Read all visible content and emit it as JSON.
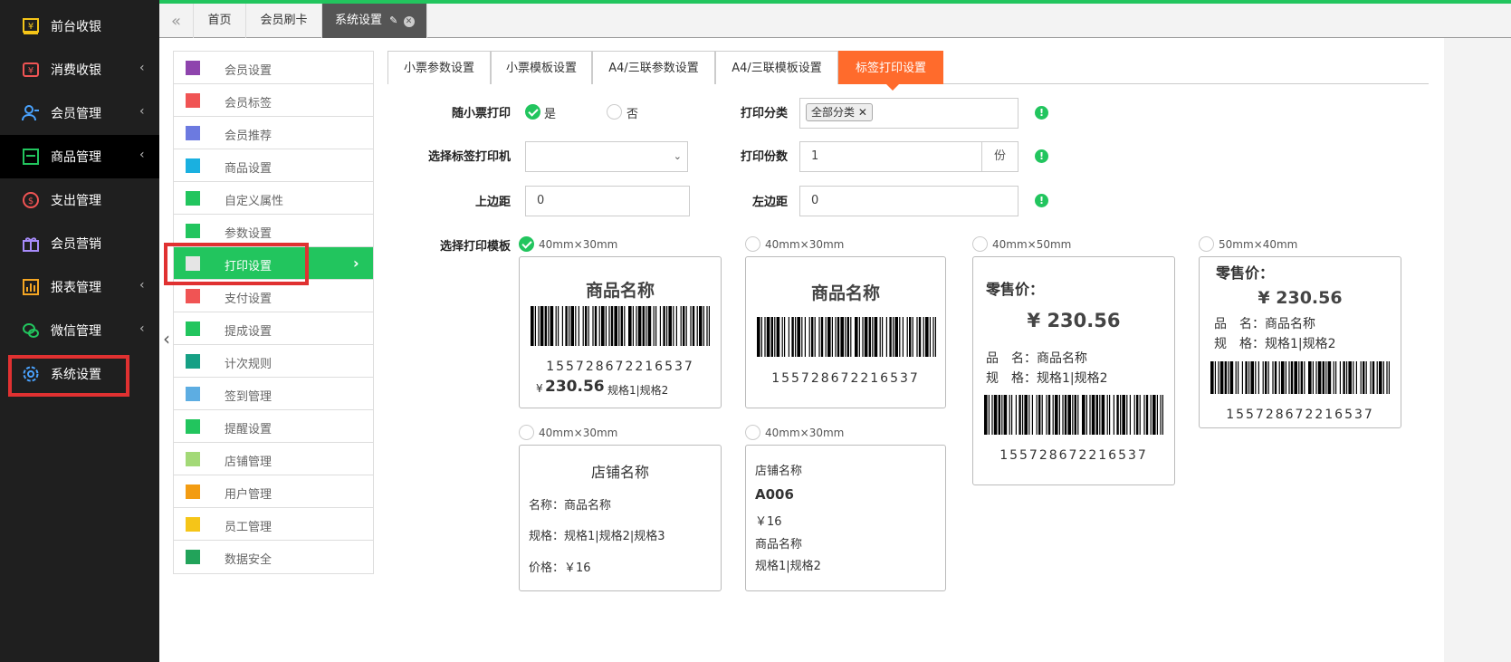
{
  "sidebar": {
    "items": [
      {
        "label": "前台收银",
        "icon": "cashier-icon",
        "arrow": ""
      },
      {
        "label": "消费收银",
        "icon": "consume-cashier-icon",
        "arrow": "‹"
      },
      {
        "label": "会员管理",
        "icon": "member-icon",
        "arrow": "‹"
      },
      {
        "label": "商品管理",
        "icon": "goods-icon",
        "arrow": "‹"
      },
      {
        "label": "支出管理",
        "icon": "expense-icon",
        "arrow": ""
      },
      {
        "label": "会员营销",
        "icon": "gift-icon",
        "arrow": ""
      },
      {
        "label": "报表管理",
        "icon": "report-icon",
        "arrow": "‹"
      },
      {
        "label": "微信管理",
        "icon": "wechat-icon",
        "arrow": "‹"
      },
      {
        "label": "系统设置",
        "icon": "gear-icon",
        "arrow": ""
      }
    ]
  },
  "tabs": {
    "collapse": "«",
    "items": [
      "首页",
      "会员刷卡",
      "系统设置"
    ]
  },
  "submenu": {
    "items": [
      {
        "label": "会员设置",
        "icon": "member-settings-icon"
      },
      {
        "label": "会员标签",
        "icon": "tag-icon"
      },
      {
        "label": "会员推荐",
        "icon": "recommend-icon"
      },
      {
        "label": "商品设置",
        "icon": "goods-settings-icon"
      },
      {
        "label": "自定义属性",
        "icon": "edit-icon"
      },
      {
        "label": "参数设置",
        "icon": "sliders-icon"
      },
      {
        "label": "打印设置",
        "icon": "printer-icon"
      },
      {
        "label": "支付设置",
        "icon": "payment-icon"
      },
      {
        "label": "提成设置",
        "icon": "commission-icon"
      },
      {
        "label": "计次规则",
        "icon": "rules-icon"
      },
      {
        "label": "签到管理",
        "icon": "checkin-icon"
      },
      {
        "label": "提醒设置",
        "icon": "bell-icon"
      },
      {
        "label": "店铺管理",
        "icon": "store-icon"
      },
      {
        "label": "用户管理",
        "icon": "user-icon"
      },
      {
        "label": "员工管理",
        "icon": "staff-icon"
      },
      {
        "label": "数据安全",
        "icon": "chart-icon"
      }
    ]
  },
  "content_tabs": [
    "小票参数设置",
    "小票模板设置",
    "A4/三联参数设置",
    "A4/三联模板设置",
    "标签打印设置"
  ],
  "form": {
    "receipt_print_label": "随小票打印",
    "yes": "是",
    "no": "否",
    "print_category_label": "打印分类",
    "category_tag": "全部分类",
    "printer_label": "选择标签打印机",
    "copies_label": "打印份数",
    "copies_value": "1",
    "copies_unit": "份",
    "top_margin_label": "上边距",
    "top_margin_value": "0",
    "left_margin_label": "左边距",
    "left_margin_value": "0",
    "template_label": "选择打印模板"
  },
  "templates": {
    "t1": {
      "size": "40mm×30mm",
      "name": "商品名称",
      "barcode": "155728672216537",
      "currency": "¥",
      "price": "230.56",
      "spec": "规格1|规格2"
    },
    "t2": {
      "size": "40mm×30mm",
      "name": "商品名称",
      "barcode": "155728672216537"
    },
    "t3": {
      "size": "40mm×50mm",
      "price_label": "零售价：",
      "price": "¥ 230.56",
      "name_line": "品　名：商品名称",
      "spec_line": "规　格：规格1|规格2",
      "barcode": "155728672216537"
    },
    "t4": {
      "size": "50mm×40mm",
      "price_label": "零售价：",
      "price": "¥ 230.56",
      "name_line": "品　名：商品名称",
      "spec_line": "规　格：规格1|规格2",
      "barcode": "155728672216537"
    },
    "t5": {
      "size": "40mm×30mm",
      "store": "店铺名称",
      "name_line": "名称：商品名称",
      "spec_line": "规格：规格1|规格2|规格3",
      "price_line": "价格：￥16"
    },
    "t6": {
      "size": "40mm×30mm",
      "store": "店铺名称",
      "code": "A006",
      "price": "￥16",
      "name": "商品名称",
      "spec": "规格1|规格2"
    }
  },
  "colors": {
    "accent": "#22c55e",
    "orange": "#ff6b2c",
    "highlight": "#e03131"
  }
}
